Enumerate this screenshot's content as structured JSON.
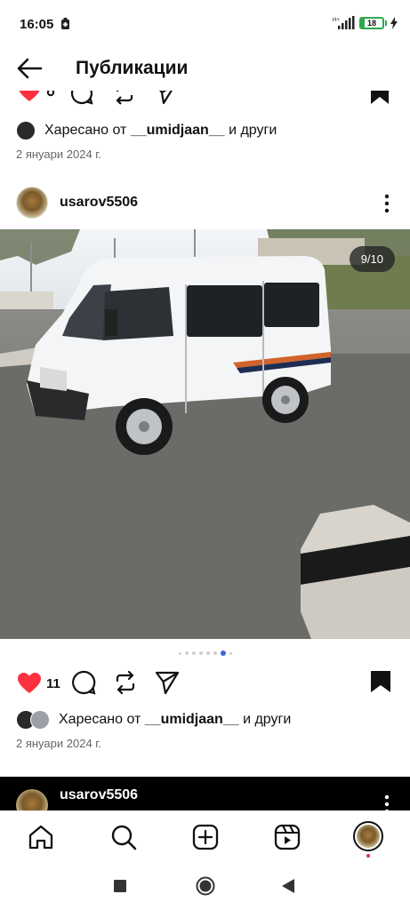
{
  "status_bar": {
    "time": "16:05",
    "network": "H+",
    "battery": "18",
    "battery_level": 0.18
  },
  "header": {
    "title": "Публикации"
  },
  "prev_post": {
    "liked_by_prefix": "Харесано от",
    "liked_by_user": "__umidjaan__",
    "liked_by_suffix": "и други",
    "date": "2 януари 2024 г."
  },
  "post": {
    "username": "usarov5506",
    "photo_counter": "9/10",
    "carousel": {
      "total": 8,
      "active_index": 6
    },
    "like_count": "11",
    "liked_by_prefix": "Харесано от",
    "liked_by_user": "__umidjaan__",
    "liked_by_suffix": "и други",
    "date": "2 януари 2024 г."
  },
  "next_post": {
    "username": "usarov5506"
  },
  "colors": {
    "like_red": "#ff3040",
    "dot_active": "#3b64e0",
    "battery_green": "#2fa84f"
  },
  "icons": {
    "back": "arrow-left-icon",
    "like": "heart-icon",
    "comment": "comment-icon",
    "repost": "repost-icon",
    "share": "send-icon",
    "save": "bookmark-icon",
    "more": "more-vertical-icon",
    "home": "home-icon",
    "search": "search-icon",
    "create": "plus-square-icon",
    "reels": "reels-icon"
  }
}
